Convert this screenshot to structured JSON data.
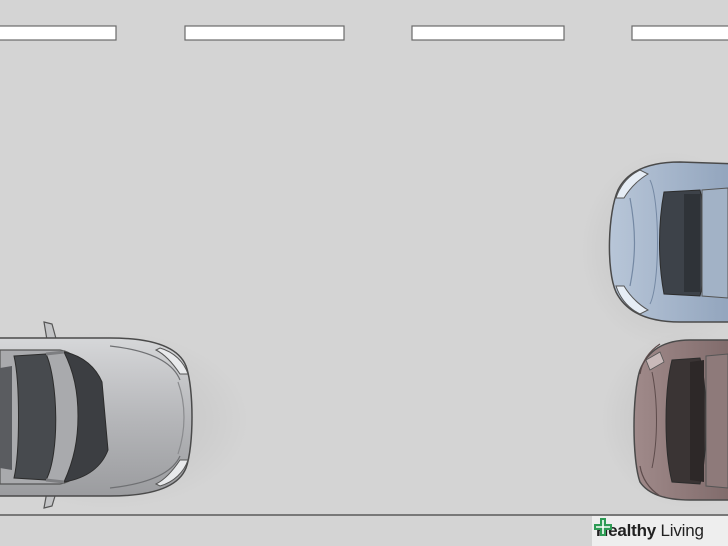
{
  "watermark": {
    "brand_bold": "Healthy",
    "brand_regular": " Living",
    "logo_icon": "green-cross-icon"
  },
  "scene": {
    "road_color": "#d4d4d4",
    "lane_marking_color": "#ffffff",
    "curb_line_color": "#5a5a5a",
    "cars": [
      {
        "name": "parked-car-left",
        "color": "#b9babc"
      },
      {
        "name": "parked-car-front",
        "color": "#9eb0c7"
      },
      {
        "name": "parked-car-rear",
        "color": "#8c7777"
      }
    ]
  }
}
